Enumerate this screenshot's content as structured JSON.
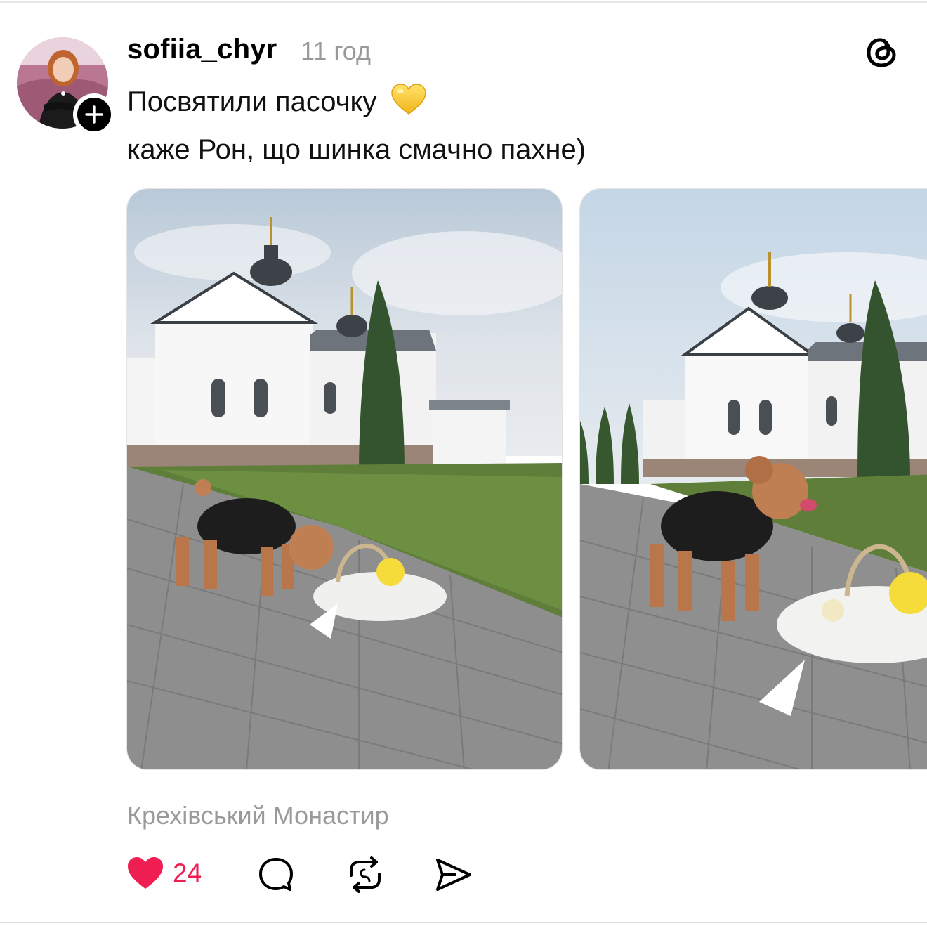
{
  "post": {
    "username": "sofiia_chyr",
    "timestamp": "11 год",
    "caption_line1": "Посвятили пасочку",
    "caption_emoji": "yellow-heart",
    "caption_line2": "каже Рон, що шинка смачно пахне)",
    "location": "Крехівський Монастир",
    "likes": "24"
  },
  "icons": {
    "logo": "threads-logo-icon",
    "follow": "plus-icon",
    "like": "heart-filled-icon",
    "comment": "comment-bubble-icon",
    "repost": "repost-icon",
    "share": "send-icon"
  },
  "colors": {
    "like_active": "#ee1d52",
    "muted_text": "#999999",
    "text": "#000000"
  }
}
